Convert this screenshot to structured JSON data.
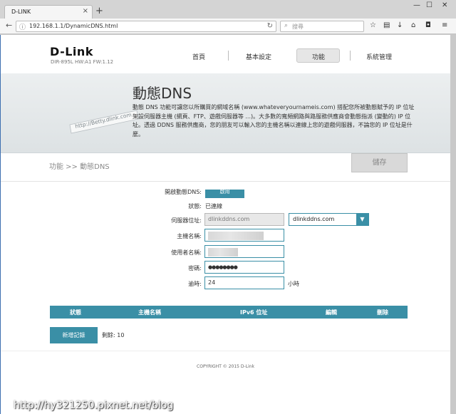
{
  "browser": {
    "tab_title": "D-LINK",
    "tab_close": "×",
    "new_tab": "+",
    "url": "192.168.1.1/DynamicDNS.html",
    "search_placeholder": "搜尋",
    "minimize": "—",
    "maximize": "☐",
    "close": "✕"
  },
  "header": {
    "logo": "D-Link",
    "model": "DIR-895L HW:A1 FW:1.12",
    "menu": [
      "首頁",
      "基本設定",
      "功能",
      "系統管理"
    ],
    "active_menu": "功能"
  },
  "banner": {
    "title": "動態DNS",
    "description": "動態 DNS 功能可讓您以所購買的網域名稱 (www.whateveryournameis.com) 搭配您所被動態賦予的 IP 位址架設伺服器主機 (網頁、FTP、遊戲伺服器等 ...)。大多數的寬頻網路與路服務供應商會動態指派 (變動的) IP 位址。透過 DDNS 服務供應商，您的朋友可以輸入您的主機名稱以連線上您的遊戲伺服器，不論您的 IP 位址是什麼。",
    "art_text": "http://Betty.dlink.com"
  },
  "crumb": "功能 >> 動態DNS",
  "save_label": "儲存",
  "form": {
    "enable_label": "開啟動態DNS:",
    "enable_value": "啟用",
    "status_label": "狀態:",
    "status_value": "已連線",
    "server_label": "伺服器位址:",
    "server_value": "dlinkddns.com",
    "server_select": "dlinkddns.com",
    "host_label": "主機名稱:",
    "user_label": "使用者名稱:",
    "password_label": "密碼:",
    "password_value": "●●●●●●●●",
    "timeout_label": "逾時:",
    "timeout_value": "24",
    "timeout_unit": "小時"
  },
  "table": {
    "headers": [
      "狀態",
      "主機名稱",
      "IPv6 位址",
      "編輯",
      "刪除"
    ]
  },
  "add_label": "新增記錄",
  "remaining": "剩餘: 10",
  "copyright": "COPYRIGHT © 2015 D-Link",
  "watermark": "http://hy321250.pixnet.net/blog",
  "colors": {
    "accent": "#3a8fa6"
  }
}
